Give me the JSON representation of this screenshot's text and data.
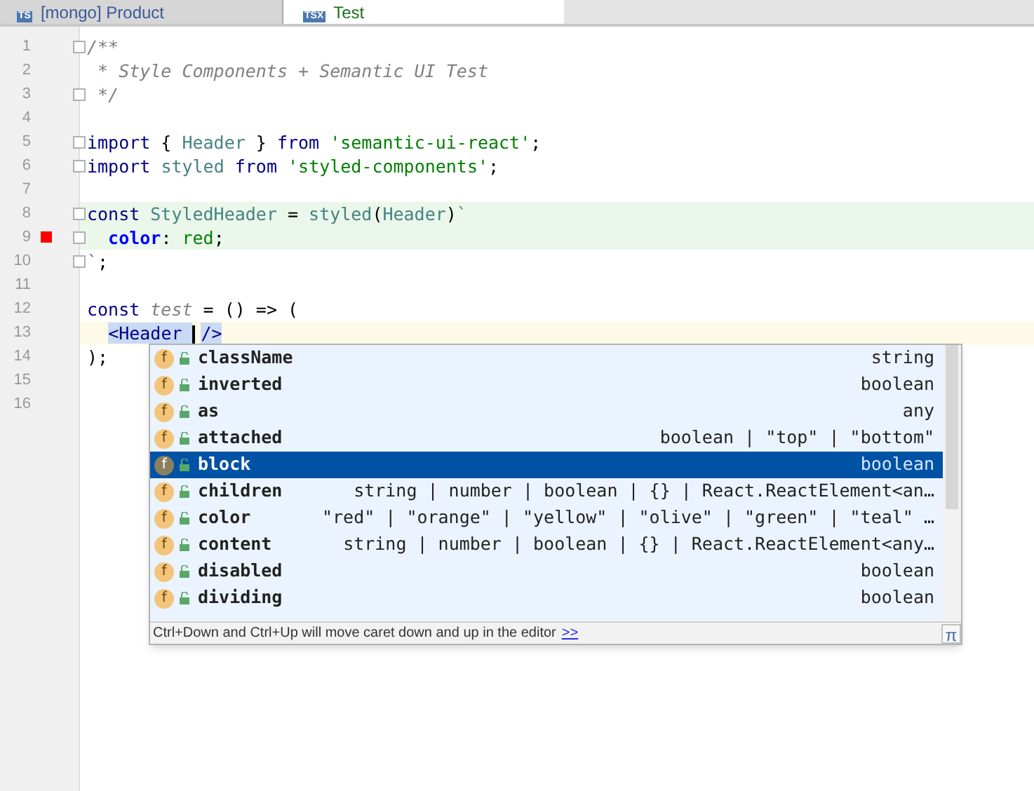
{
  "tabs": [
    {
      "label": "[mongo] Product",
      "badge": "TS",
      "selected": false
    },
    {
      "label": "Test",
      "badge": "TSX",
      "selected": true
    }
  ],
  "editor": {
    "lines": [
      {
        "number": "1",
        "fold": true,
        "breakpoint": false,
        "injected": false,
        "current": false,
        "tokens": [
          {
            "kind": "comment",
            "text": "/**"
          }
        ]
      },
      {
        "number": "2",
        "fold": false,
        "breakpoint": false,
        "injected": false,
        "current": false,
        "tokens": [
          {
            "kind": "comment",
            "text": " * Style Components + Semantic UI Test"
          }
        ]
      },
      {
        "number": "3",
        "fold": true,
        "breakpoint": false,
        "injected": false,
        "current": false,
        "tokens": [
          {
            "kind": "comment",
            "text": " */"
          }
        ]
      },
      {
        "number": "4",
        "fold": false,
        "breakpoint": false,
        "injected": false,
        "current": false
      },
      {
        "number": "5",
        "fold": true,
        "breakpoint": false,
        "injected": false,
        "current": false,
        "tokens": [
          {
            "kind": "keyword",
            "text": "import"
          },
          {
            "kind": "plain",
            "text": " { "
          },
          {
            "kind": "ident",
            "text": "Header"
          },
          {
            "kind": "plain",
            "text": " } "
          },
          {
            "kind": "keyword",
            "text": "from "
          },
          {
            "kind": "string",
            "text": "'semantic-ui-react'"
          },
          {
            "kind": "plain",
            "text": ";"
          }
        ]
      },
      {
        "number": "6",
        "fold": true,
        "breakpoint": false,
        "injected": false,
        "current": false,
        "tokens": [
          {
            "kind": "keyword",
            "text": "import "
          },
          {
            "kind": "ident",
            "text": "styled "
          },
          {
            "kind": "keyword",
            "text": "from "
          },
          {
            "kind": "string",
            "text": "'styled-components'"
          },
          {
            "kind": "plain",
            "text": ";"
          }
        ]
      },
      {
        "number": "7",
        "fold": false,
        "breakpoint": false,
        "injected": false,
        "current": false
      },
      {
        "number": "8",
        "fold": true,
        "breakpoint": false,
        "injected": true,
        "current": false,
        "tokens": [
          {
            "kind": "keyword",
            "text": "const "
          },
          {
            "kind": "ident",
            "text": "StyledHeader"
          },
          {
            "kind": "plain",
            "text": " = "
          },
          {
            "kind": "ident",
            "text": "styled"
          },
          {
            "kind": "plain",
            "text": "("
          },
          {
            "kind": "ident",
            "text": "Header"
          },
          {
            "kind": "plain",
            "text": ")"
          },
          {
            "kind": "ident",
            "text": "`"
          }
        ]
      },
      {
        "number": "9",
        "fold": true,
        "breakpoint": true,
        "injected": true,
        "current": false,
        "tokens": [
          {
            "kind": "property",
            "text": "  color"
          },
          {
            "kind": "plain",
            "text": ": "
          },
          {
            "kind": "string",
            "text": "red"
          },
          {
            "kind": "plain",
            "text": ";"
          }
        ]
      },
      {
        "number": "10",
        "fold": true,
        "breakpoint": false,
        "injected": false,
        "current": false,
        "tokens": [
          {
            "kind": "ident",
            "text": "`"
          },
          {
            "kind": "plain",
            "text": ";"
          }
        ]
      },
      {
        "number": "11",
        "fold": false,
        "breakpoint": false,
        "injected": false,
        "current": false
      },
      {
        "number": "12",
        "fold": false,
        "breakpoint": false,
        "injected": false,
        "current": false,
        "tokens": [
          {
            "kind": "keyword",
            "text": "const "
          },
          {
            "kind": "italic",
            "text": "test"
          },
          {
            "kind": "plain",
            "text": " = () => ("
          }
        ]
      },
      {
        "number": "13",
        "fold": false,
        "breakpoint": false,
        "injected": false,
        "current": true,
        "tokens": [
          {
            "kind": "tag",
            "text": "  <Header "
          },
          {
            "kind": "caret"
          },
          {
            "kind": "tag",
            "text": "/>"
          }
        ]
      },
      {
        "number": "14",
        "fold": false,
        "breakpoint": false,
        "injected": false,
        "current": false,
        "tokens": [
          {
            "kind": "plain",
            "text": ");"
          }
        ]
      },
      {
        "number": "15",
        "fold": false,
        "breakpoint": false,
        "injected": false,
        "current": false
      },
      {
        "number": "16",
        "fold": false,
        "breakpoint": false,
        "injected": false,
        "current": false
      }
    ]
  },
  "completion": {
    "items": [
      {
        "icon": "f",
        "name": "className",
        "type": "string",
        "selected": false
      },
      {
        "icon": "f",
        "name": "inverted",
        "type": "boolean",
        "selected": false
      },
      {
        "icon": "f",
        "name": "as",
        "type": "any",
        "selected": false
      },
      {
        "icon": "f",
        "name": "attached",
        "type": "boolean | \"top\" | \"bottom\"",
        "selected": false
      },
      {
        "icon": "f",
        "name": "block",
        "type": "boolean",
        "selected": true
      },
      {
        "icon": "f",
        "name": "children",
        "type": "string | number | boolean | {} | React.ReactElement<an…",
        "selected": false
      },
      {
        "icon": "f",
        "name": "color",
        "type": "\"red\" | \"orange\" | \"yellow\" | \"olive\" | \"green\" | \"teal\" …",
        "selected": false
      },
      {
        "icon": "f",
        "name": "content",
        "type": "string | number | boolean | {} | React.ReactElement<any…",
        "selected": false
      },
      {
        "icon": "f",
        "name": "disabled",
        "type": "boolean",
        "selected": false
      },
      {
        "icon": "f",
        "name": "dividing",
        "type": "boolean",
        "selected": false
      }
    ],
    "hint": "Ctrl+Down and Ctrl+Up will move caret down and up in the editor",
    "hint_link": ">>",
    "corner": "π"
  }
}
